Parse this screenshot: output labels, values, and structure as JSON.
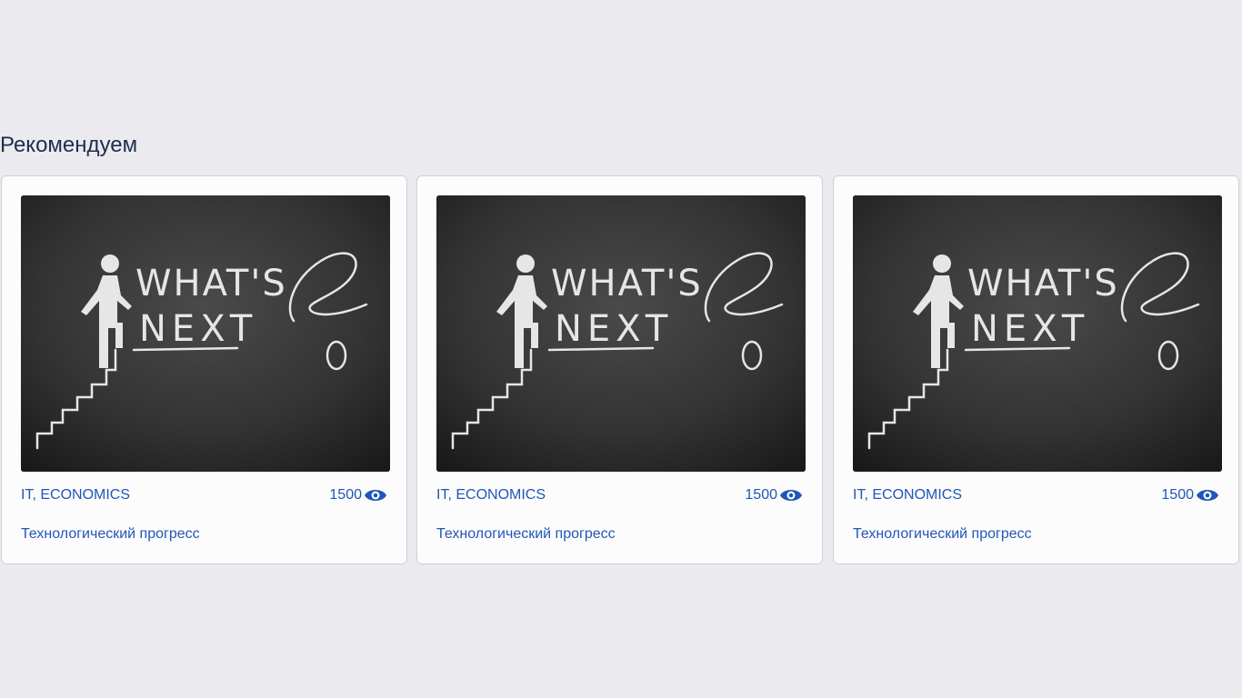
{
  "section": {
    "title": "Рекомендуем"
  },
  "cards": [
    {
      "image": {
        "name": "whats-next-chalkboard-image",
        "text_line1": "WHAT'S",
        "text_line2": "NEXT",
        "symbol": "?"
      },
      "tags": "IT, ECONOMICS",
      "views": "1500",
      "views_icon": "eye-icon",
      "title": "Технологический прогресс"
    },
    {
      "image": {
        "name": "whats-next-chalkboard-image",
        "text_line1": "WHAT'S",
        "text_line2": "NEXT",
        "symbol": "?"
      },
      "tags": "IT, ECONOMICS",
      "views": "1500",
      "views_icon": "eye-icon",
      "title": "Технологический прогресс"
    },
    {
      "image": {
        "name": "whats-next-chalkboard-image",
        "text_line1": "WHAT'S",
        "text_line2": "NEXT",
        "symbol": "?"
      },
      "tags": "IT, ECONOMICS",
      "views": "1500",
      "views_icon": "eye-icon",
      "title": "Технологический прогресс"
    }
  ],
  "colors": {
    "background": "#ebebef",
    "link": "#2156b8",
    "heading": "#1f2d50",
    "chalkboard": "#2b2b2b",
    "chalk": "#e8e8e8"
  }
}
